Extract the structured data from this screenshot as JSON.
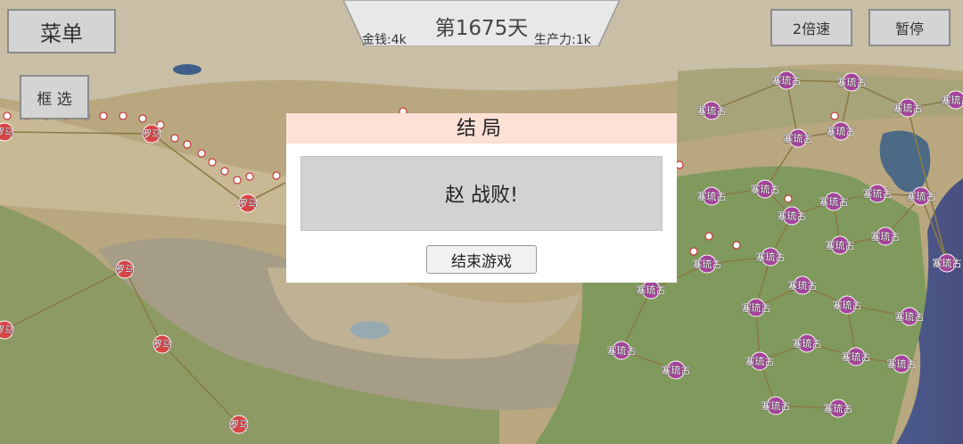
{
  "menu_label": "菜单",
  "box_select_label": "框 选",
  "speed_label": "2倍速",
  "pause_label": "暂停",
  "hud": {
    "day": "第1675天",
    "money": "金钱:4k",
    "production": "生产力:1k"
  },
  "dialog": {
    "title": "结局",
    "message": "赵 战败!",
    "end_button": "结束游戏"
  },
  "colors": {
    "rome": "#d64545",
    "seleucid": "#a6449c",
    "unit_marker": "#c83a3a",
    "road": "#8a7b45"
  },
  "rome_label": "罗马",
  "seleucid_label": "塞琉古"
}
